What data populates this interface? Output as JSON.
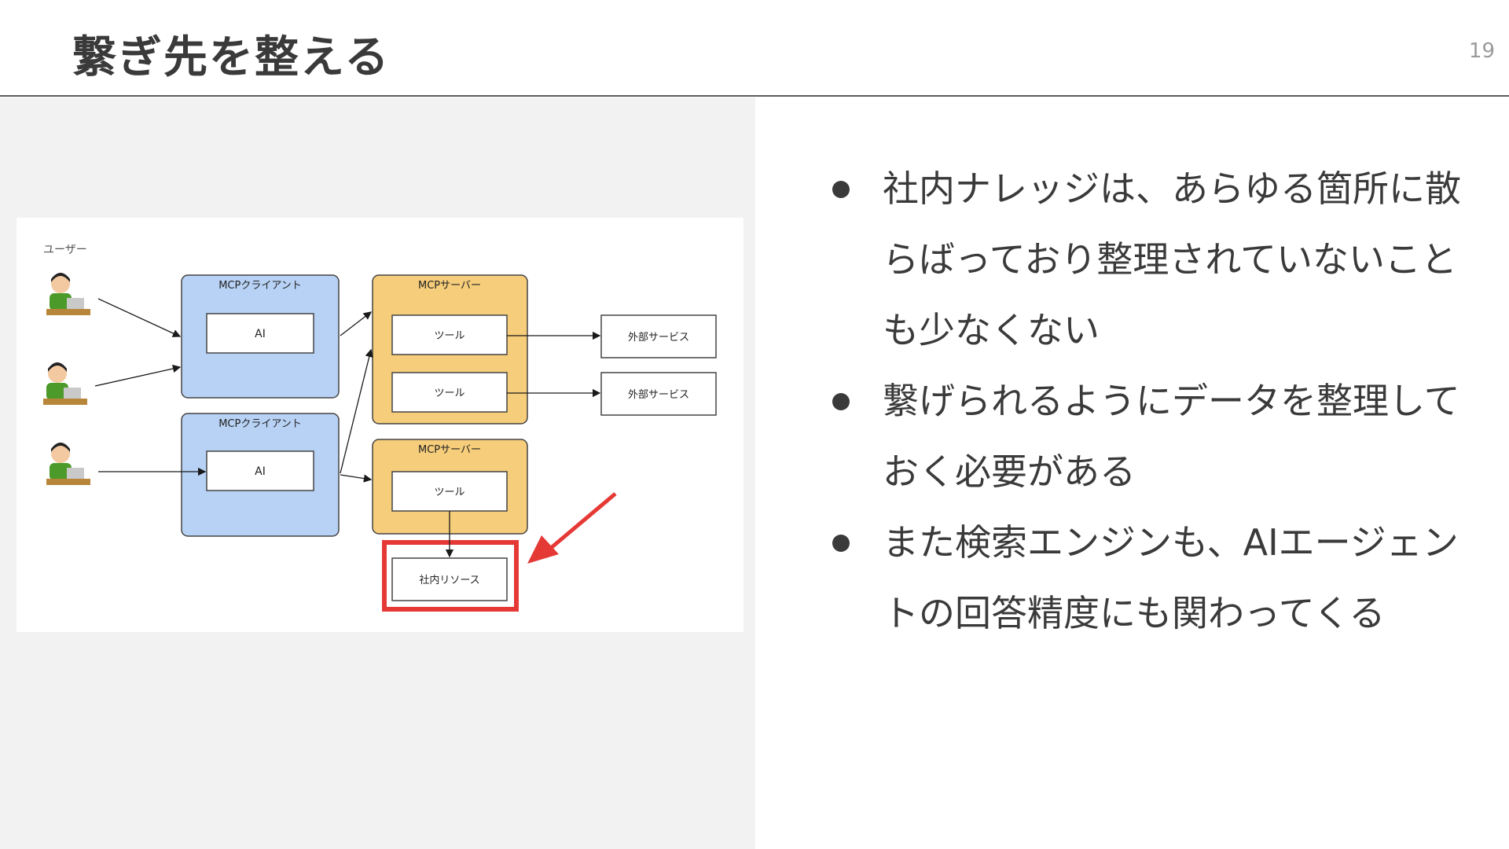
{
  "slide": {
    "title": "繋ぎ先を整える",
    "page_number": "19"
  },
  "bullets": [
    "社内ナレッジは、あらゆる箇所に散らばっており整理されていないことも少なくない",
    "繋げられるようにデータを整理しておく必要がある",
    "また検索エンジンも、AIエージェントの回答精度にも関わってくる"
  ],
  "diagram": {
    "users_label": "ユーザー",
    "clients": [
      {
        "title": "MCPクライアント",
        "inner": "AI"
      },
      {
        "title": "MCPクライアント",
        "inner": "AI"
      }
    ],
    "servers": [
      {
        "title": "MCPサーバー",
        "tools": [
          "ツール",
          "ツール"
        ]
      },
      {
        "title": "MCPサーバー",
        "tools": [
          "ツール"
        ]
      }
    ],
    "external_services": [
      "外部サービス",
      "外部サービス"
    ],
    "internal_resource": "社内リソース",
    "colors": {
      "client_fill": "#b8d2f5",
      "server_fill": "#f6cd7a",
      "highlight": "#e53935",
      "arrow": "#1a1a1a"
    }
  }
}
